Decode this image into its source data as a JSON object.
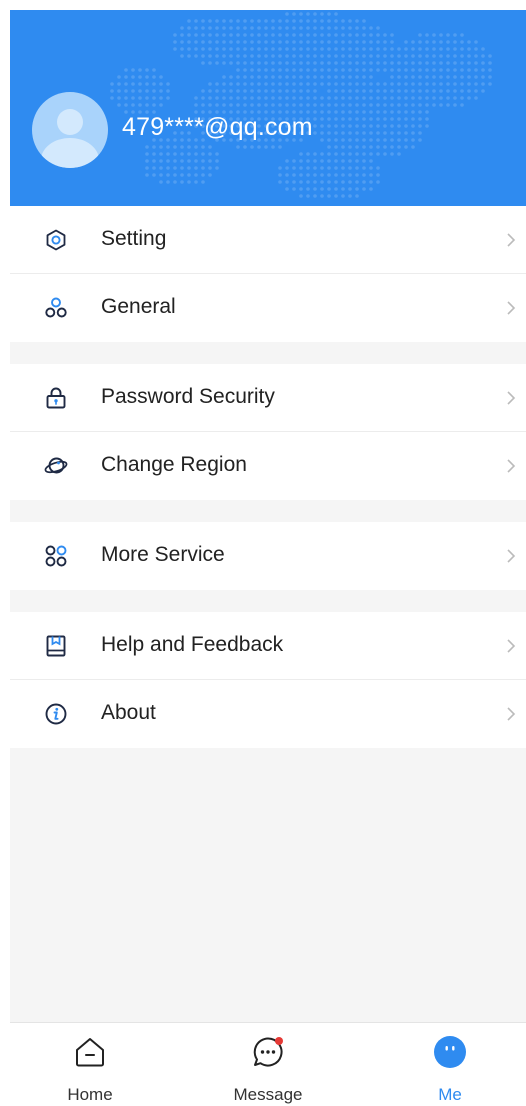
{
  "profile": {
    "email": "479****@qq.com",
    "avatar_icon": "default-avatar-icon"
  },
  "colors": {
    "accent": "#2f8bf0",
    "text": "#222222",
    "chevron": "#bbbbbb",
    "badge": "#e53935"
  },
  "menu": {
    "setting": {
      "label": "Setting",
      "icon": "settings-hexagon-icon"
    },
    "general": {
      "label": "General",
      "icon": "general-nodes-icon"
    },
    "password_security": {
      "label": "Password Security",
      "icon": "lock-icon"
    },
    "change_region": {
      "label": "Change Region",
      "icon": "planet-icon"
    },
    "more_service": {
      "label": "More Service",
      "icon": "grid-services-icon"
    },
    "help_feedback": {
      "label": "Help and Feedback",
      "icon": "book-icon"
    },
    "about": {
      "label": "About",
      "icon": "info-icon"
    }
  },
  "tabbar": {
    "home": {
      "label": "Home",
      "icon": "home-icon"
    },
    "message": {
      "label": "Message",
      "icon": "message-bubble-icon",
      "has_badge": true
    },
    "me": {
      "label": "Me",
      "icon": "me-face-icon",
      "active": true
    }
  }
}
